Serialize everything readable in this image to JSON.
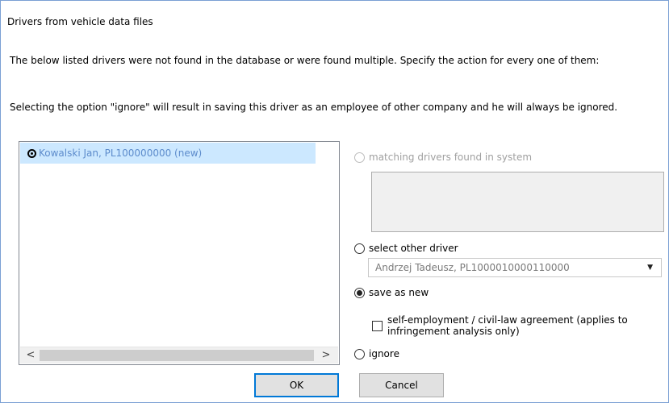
{
  "dialog": {
    "title": "Drivers from vehicle data files",
    "instruction": "The below listed drivers were not found in the database or were found multiple. Specify the action for every one of them:",
    "ignore_note": "Selecting the option \"ignore\" will result in saving this driver as an employee of other company and he will always be ignored."
  },
  "drivers_list": {
    "items": [
      {
        "label": "Kowalski Jan, PL100000000 (new)",
        "icon": "driver-card-icon",
        "selected": true
      }
    ],
    "scroll_left": "<",
    "scroll_right": ">"
  },
  "options": {
    "matching": {
      "label": "matching drivers found in system",
      "enabled": false,
      "checked": false
    },
    "select_other": {
      "label": "select other driver",
      "enabled": true,
      "checked": false
    },
    "select_other_value": "Andrzej Tadeusz, PL1000010000110000",
    "save_as_new": {
      "label": "save as new",
      "enabled": true,
      "checked": true
    },
    "self_employment": {
      "label": "self-employment / civil-law agreement (applies to infringement analysis only)",
      "checked": false
    },
    "ignore": {
      "label": "ignore",
      "enabled": true,
      "checked": false
    }
  },
  "buttons": {
    "ok": "OK",
    "cancel": "Cancel"
  },
  "colors": {
    "selection_bg": "#cce8ff",
    "selection_text": "#5d8ccc",
    "focus_border": "#0078d7",
    "window_border": "#7aa0d4"
  }
}
